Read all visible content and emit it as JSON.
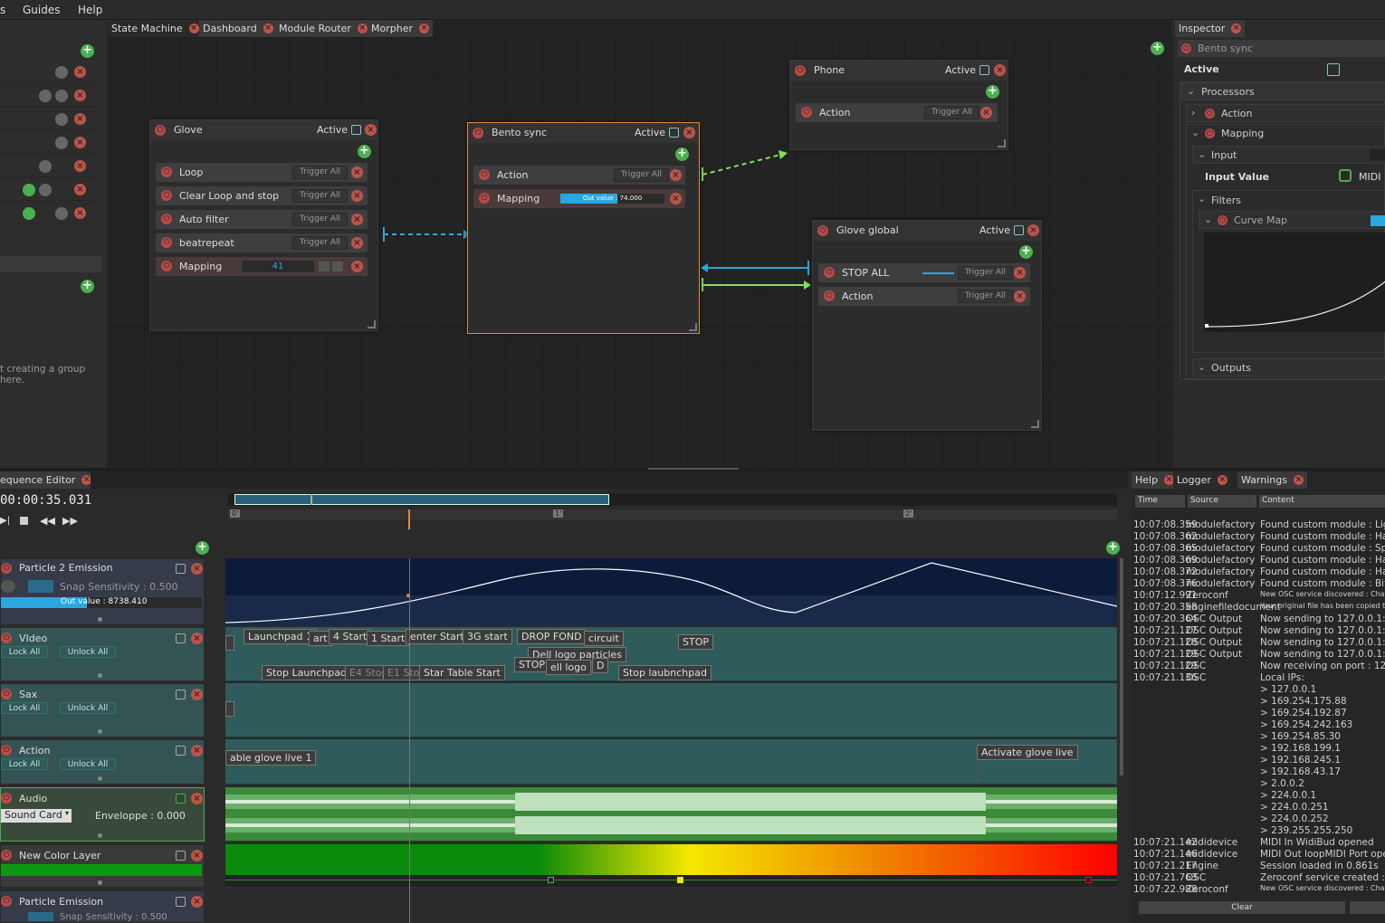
{
  "menu": {
    "items": [
      "s",
      "Guides",
      "Help"
    ]
  },
  "tabs": {
    "items": [
      "State Machine",
      "Dashboard",
      "Module Router",
      "Morpher"
    ],
    "inspector": "Inspector"
  },
  "left_panel": {
    "hint": "t creating a group here."
  },
  "nodes": {
    "glove": {
      "title": "Glove",
      "active_label": "Active",
      "rows": [
        {
          "label": "Loop",
          "btn": "Trigger All"
        },
        {
          "label": "Clear Loop and stop",
          "btn": "Trigger All"
        },
        {
          "label": "Auto filter",
          "btn": "Trigger All"
        },
        {
          "label": "beatrepeat",
          "btn": "Trigger All"
        }
      ],
      "mapping_label": "Mapping",
      "mapping_value": "41"
    },
    "bento": {
      "title": "Bento sync",
      "active_label": "Active",
      "action_label": "Action",
      "action_btn": "Trigger All",
      "mapping_label": "Mapping",
      "mapping_out": "Out value : 74.000"
    },
    "phone": {
      "title": "Phone",
      "active_label": "Active",
      "action_label": "Action",
      "action_btn": "Trigger All"
    },
    "glove_global": {
      "title": "Glove global",
      "active_label": "Active",
      "rows": [
        {
          "label": "STOP ALL",
          "btn": "Trigger All"
        },
        {
          "label": "Action",
          "btn": "Trigger All"
        }
      ]
    }
  },
  "inspector": {
    "selected": "Bento sync",
    "active_label": "Active",
    "processors_label": "Processors",
    "action_label": "Action",
    "mapping_label": "Mapping",
    "input_label": "Input",
    "input_value_label": "Input Value",
    "input_value_source": "MIDI",
    "filters_label": "Filters",
    "curve_map_label": "Curve Map",
    "outputs_label": "Outputs"
  },
  "sequence": {
    "title": "equence Editor",
    "time": "00:00:35.031",
    "ruler_marks": [
      "0'",
      "1'",
      "2'"
    ],
    "layers": [
      {
        "name": "Particle 2 Emission",
        "snap": "Snap Sensitivity : 0.500",
        "out": "Out value : 8738.410"
      },
      {
        "name": "VIdeo",
        "lock": "Lock All",
        "unlock": "Unlock All"
      },
      {
        "name": "Sax",
        "lock": "Lock All",
        "unlock": "Unlock All"
      },
      {
        "name": "Action",
        "lock": "Lock All",
        "unlock": "Unlock All"
      },
      {
        "name": "Audio",
        "device": "Sound Card",
        "env": "Enveloppe : 0.000"
      },
      {
        "name": "New Color Layer"
      },
      {
        "name": "Particle Emission",
        "snap": "Snap Sensitivity : 0.500"
      }
    ],
    "video_triggers": [
      "Launchpad 1",
      "art",
      "4 Start",
      "1 Start",
      "enter Start",
      "3G start",
      "DROP FOND",
      "circuit",
      "Dell logo particles",
      "STOP",
      "Stop Launchpad",
      "E4 Stop",
      "E1 Stop",
      "Star Table Start",
      "STOP",
      "ell logo",
      "D",
      "Stop laubnchpad"
    ],
    "action_triggers": [
      "able glove live 1",
      "Activate glove live"
    ]
  },
  "bottom_tabs": [
    "Help",
    "Logger",
    "Warnings"
  ],
  "logger": {
    "columns": [
      "Time",
      "Source",
      "Content"
    ],
    "clear": "Clear",
    "rows": [
      {
        "t": "10:07:08.359",
        "s": "modulefactory",
        "c": "Found custom module : Lig"
      },
      {
        "t": "10:07:08.362",
        "s": "modulefactory",
        "c": "Found custom module : Har"
      },
      {
        "t": "10:07:08.365",
        "s": "modulefactory",
        "c": "Found custom module : Spe"
      },
      {
        "t": "10:07:08.369",
        "s": "modulefactory",
        "c": "Found custom module : Har"
      },
      {
        "t": "10:07:08.372",
        "s": "modulefactory",
        "c": "Found custom module : Har"
      },
      {
        "t": "10:07:08.376",
        "s": "modulefactory",
        "c": "Found custom module : Bit"
      },
      {
        "t": "10:07:12.991",
        "s": "Zeroconf",
        "c": "New OSC service discovered : Chataign"
      },
      {
        "t": "10:07:20.358",
        "s": "enginefiledocument",
        "c": "Your original file has been copied to D:"
      },
      {
        "t": "10:07:20.364",
        "s": "OSC Output",
        "c": "Now sending to 127.0.0.1:1"
      },
      {
        "t": "10:07:21.127",
        "s": "OSC Output",
        "c": "Now sending to 127.0.0.1:7"
      },
      {
        "t": "10:07:21.128",
        "s": "OSC Output",
        "c": "Now sending to 127.0.0.1:4"
      },
      {
        "t": "10:07:21.129",
        "s": "OSC Output",
        "c": "Now sending to 127.0.0.1:9"
      },
      {
        "t": "10:07:21.129",
        "s": "OSC",
        "c": "Now receiving on port : 120"
      },
      {
        "t": "10:07:21.136",
        "s": "OSC",
        "c": "Local IPs:"
      },
      {
        "t": "",
        "s": "",
        "c": "> 127.0.0.1"
      },
      {
        "t": "",
        "s": "",
        "c": "> 169.254.175.88"
      },
      {
        "t": "",
        "s": "",
        "c": "> 169.254.192.87"
      },
      {
        "t": "",
        "s": "",
        "c": "> 169.254.242.163"
      },
      {
        "t": "",
        "s": "",
        "c": "> 169.254.85.30"
      },
      {
        "t": "",
        "s": "",
        "c": "> 192.168.199.1"
      },
      {
        "t": "",
        "s": "",
        "c": "> 192.168.245.1"
      },
      {
        "t": "",
        "s": "",
        "c": "> 192.168.43.17"
      },
      {
        "t": "",
        "s": "",
        "c": "> 2.0.0.2"
      },
      {
        "t": "",
        "s": "",
        "c": "> 224.0.0.1"
      },
      {
        "t": "",
        "s": "",
        "c": "> 224.0.0.251"
      },
      {
        "t": "",
        "s": "",
        "c": "> 224.0.0.252"
      },
      {
        "t": "",
        "s": "",
        "c": "> 239.255.255.250"
      },
      {
        "t": "10:07:21.142",
        "s": "mididevice",
        "c": "MIDI In WidiBud opened"
      },
      {
        "t": "10:07:21.146",
        "s": "mididevice",
        "c": "MIDI Out loopMIDI Port ope"
      },
      {
        "t": "10:07:21.217",
        "s": "Engine",
        "c": "Session loaded in 0.861s"
      },
      {
        "t": "10:07:21.763",
        "s": "OSC",
        "c": "Zeroconf service created : C"
      },
      {
        "t": "10:07:22.988",
        "s": "Zeroconf",
        "c": "New OSC service discovered : Chataign"
      }
    ]
  },
  "colors": {
    "accent_orange": "#e08a2e",
    "link_blue": "#2aa7e0",
    "link_green": "#7fe25a",
    "power_red": "#b94a48",
    "add_green": "#4caf50"
  }
}
